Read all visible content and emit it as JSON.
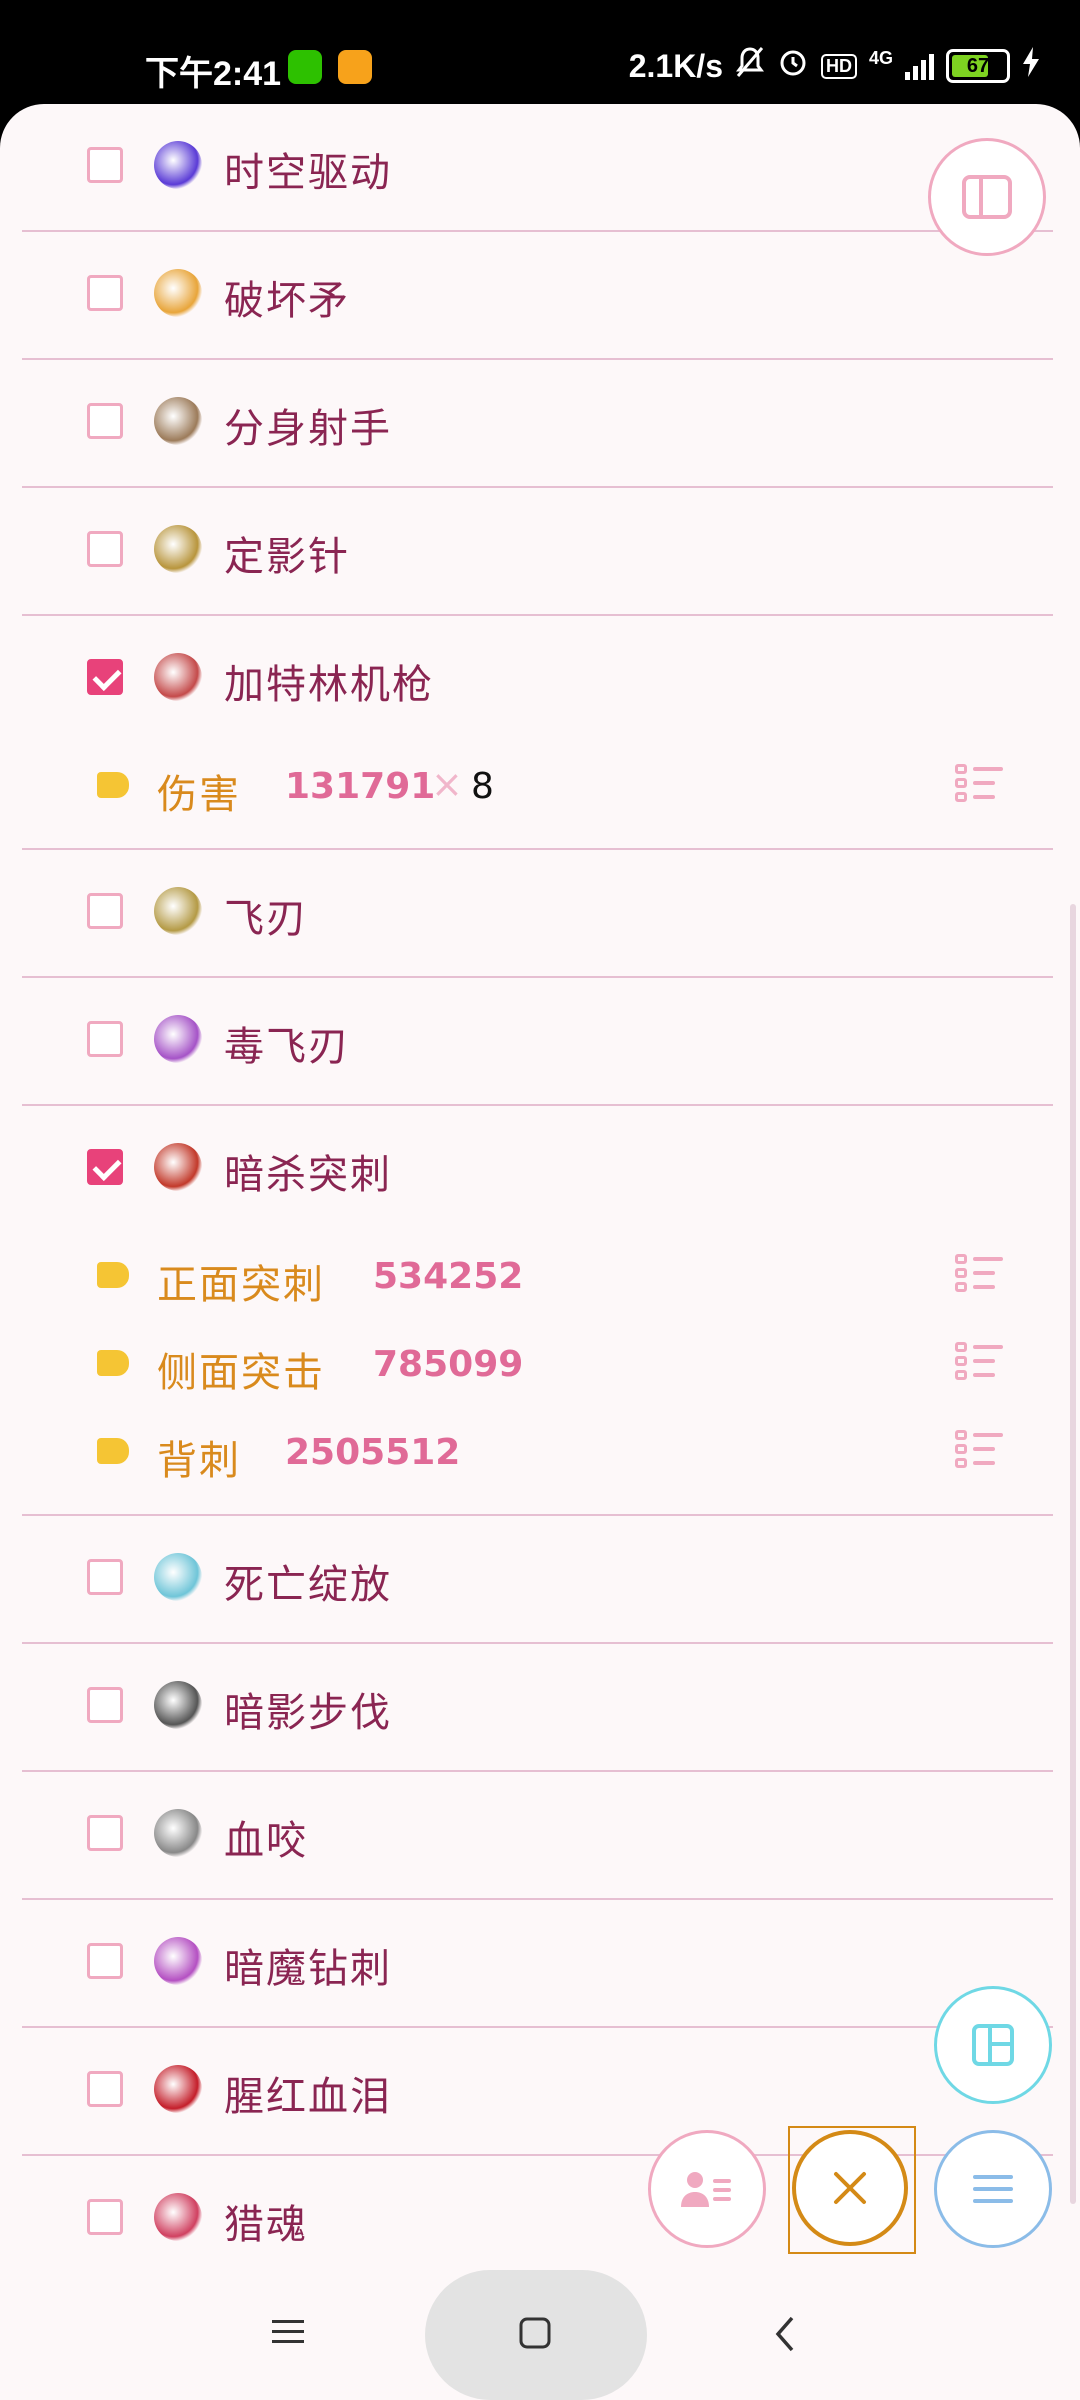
{
  "status_bar": {
    "time": "下午2:41",
    "network_speed": "2.1K/s",
    "network_type": "4G",
    "hd_label": "HD",
    "battery": "67"
  },
  "items": [
    {
      "name": "时空驱动",
      "checked": false,
      "icon": "time-drive-skill-icon",
      "color": "#5a3bd6"
    },
    {
      "name": "破坏矛",
      "checked": false,
      "icon": "spear-skill-icon",
      "color": "#e8a53a"
    },
    {
      "name": "分身射手",
      "checked": false,
      "icon": "clone-archer-skill-icon",
      "color": "#9c7b5a"
    },
    {
      "name": "定影针",
      "checked": false,
      "icon": "needle-skill-icon",
      "color": "#b8953c"
    },
    {
      "name": "加特林机枪",
      "checked": true,
      "icon": "gatling-skill-icon",
      "color": "#c44a4a",
      "details": [
        {
          "label": "伤害",
          "value": "131791",
          "times": "×",
          "multiplier": "8"
        }
      ]
    },
    {
      "name": "飞刃",
      "checked": false,
      "icon": "flying-blade-skill-icon",
      "color": "#b49a45"
    },
    {
      "name": "毒飞刃",
      "checked": false,
      "icon": "poison-blade-skill-icon",
      "color": "#a553c7"
    },
    {
      "name": "暗杀突刺",
      "checked": true,
      "icon": "assassin-strike-skill-icon",
      "color": "#c2392a",
      "details": [
        {
          "label": "正面突刺",
          "value": "534252"
        },
        {
          "label": "侧面突击",
          "value": "785099"
        },
        {
          "label": "背刺",
          "value": "2505512"
        }
      ]
    },
    {
      "name": "死亡绽放",
      "checked": false,
      "icon": "death-bloom-skill-icon",
      "color": "#6fc5d8"
    },
    {
      "name": "暗影步伐",
      "checked": false,
      "icon": "shadow-step-skill-icon",
      "color": "#555555"
    },
    {
      "name": "血咬",
      "checked": false,
      "icon": "blood-bite-skill-icon",
      "color": "#888888"
    },
    {
      "name": "暗魔钻刺",
      "checked": false,
      "icon": "dark-drill-skill-icon",
      "color": "#b450c2"
    },
    {
      "name": "腥红血泪",
      "checked": false,
      "icon": "crimson-tear-skill-icon",
      "color": "#c41e2a"
    },
    {
      "name": "猎魂",
      "checked": false,
      "icon": "soul-hunt-skill-icon",
      "color": "#d04060"
    }
  ],
  "fabs": {
    "panel": "sidebar-panel-icon",
    "layout": "layout-grid-icon",
    "contact": "contact-list-icon",
    "close": "close-icon",
    "menu": "hamburger-menu-icon"
  },
  "navbar": {
    "recent": "recent-apps-icon",
    "home": "home-icon",
    "back": "back-icon"
  },
  "colors": {
    "accent_pink": "#e8427a",
    "tag_yellow": "#f5c534",
    "label_orange": "#d98a1d",
    "value_pink": "#e06a97",
    "name_text": "#8a2552"
  }
}
